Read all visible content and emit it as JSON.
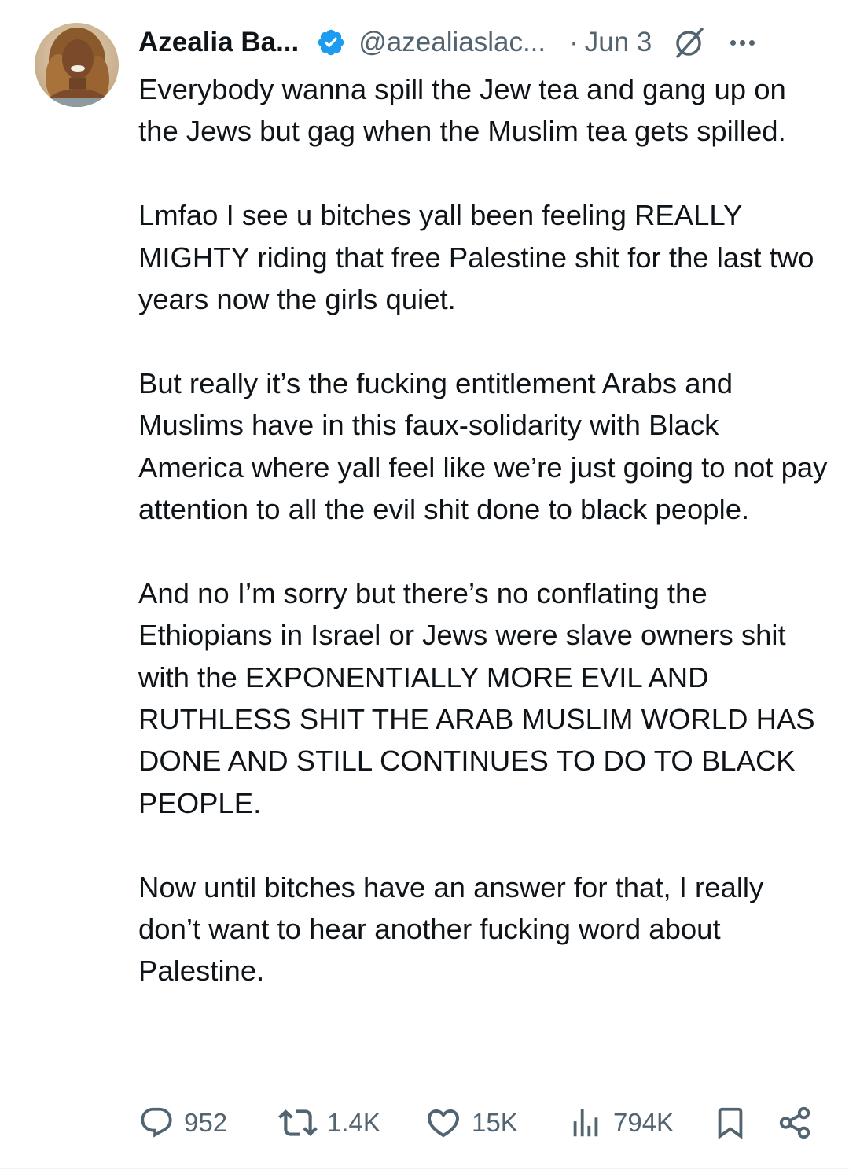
{
  "author": {
    "display_name": "Azealia Ba...",
    "handle": "@azealiaslac...",
    "separator": "·",
    "date": "Jun 3",
    "verified": true
  },
  "tweet": {
    "paragraphs": [
      "Everybody wanna spill the Jew tea and gang up on the Jews but gag when the Muslim tea gets spilled.",
      "Lmfao I see u bitches yall been feeling REALLY MIGHTY riding that free Palestine shit for the last two years now the girls quiet.",
      "But really it’s the fucking entitlement Arabs and Muslims have in this faux-solidarity with Black America where yall feel like we’re just going to not pay attention to all the evil shit done to black people.",
      "And no I’m sorry but there’s no conflating the Ethiopians in Israel or Jews were slave owners shit with the EXPONENTIALLY MORE EVIL AND RUTHLESS SHIT THE ARAB MUSLIM WORLD HAS DONE AND STILL CONTINUES TO DO TO BLACK PEOPLE.",
      "Now until bitches have an answer for that, I really don’t want to hear another fucking word about Palestine."
    ]
  },
  "metrics": {
    "replies": "952",
    "reposts": "1.4K",
    "likes": "15K",
    "views": "794K"
  },
  "colors": {
    "text": "#0f1419",
    "muted": "#536471",
    "verified": "#1d9bf0"
  },
  "icons": [
    "verified-badge-icon",
    "grok-icon",
    "more-icon",
    "reply-icon",
    "repost-icon",
    "like-icon",
    "views-icon",
    "bookmark-icon",
    "share-icon"
  ]
}
